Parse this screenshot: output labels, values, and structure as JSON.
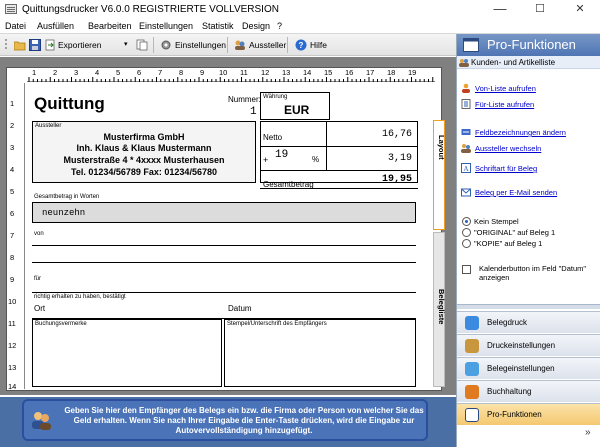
{
  "window": {
    "title": "Quittungsdrucker V6.0.0  REGISTRIERTE VOLLVERSION",
    "minimize": "—",
    "maximize": "☐",
    "close": "✕"
  },
  "menu": [
    "Datei",
    "Ausfüllen",
    "Bearbeiten",
    "Einstellungen",
    "Statistik",
    "Design",
    "?"
  ],
  "toolbar": {
    "export": "Exportieren",
    "settings": "Einstellungen",
    "issuer": "Aussteller",
    "help": "Hilfe"
  },
  "ruler": {
    "h": [
      "1",
      "2",
      "3",
      "4",
      "5",
      "6",
      "7",
      "8",
      "9",
      "10",
      "11",
      "12",
      "13",
      "14",
      "15",
      "16",
      "17",
      "18",
      "19"
    ],
    "v": [
      "1",
      "2",
      "3",
      "4",
      "5",
      "6",
      "7",
      "8",
      "9",
      "10",
      "11",
      "12",
      "13",
      "14"
    ]
  },
  "receipt": {
    "title": "Quittung",
    "number_label": "Nummer:",
    "number": "1",
    "currency_label": "Währung",
    "currency": "EUR",
    "issuer_label": "Aussteller",
    "issuer_lines": [
      "Musterfirma GmbH",
      "Inh. Klaus & Klaus Mustermann",
      "Musterstraße 4  *  4xxxx Musterhausen",
      "Tel. 01234/56789  Fax: 01234/56780"
    ],
    "netto_label": "Netto",
    "netto": "16,76",
    "tax_plus": "+",
    "tax_rate": "19",
    "tax_pct": "%",
    "tax": "3,19",
    "gross_label": "Gesamtbetrag",
    "gross": "19,95",
    "words_label": "Gesamtbetrag in Worten",
    "words": "neunzehn",
    "from_label": "von",
    "for_label": "für",
    "received_label": "richtig erhalten zu haben, bestätigt",
    "place_label": "Ort",
    "date_label": "Datum",
    "booking_label": "Buchungsvermerke",
    "signature_label": "Stempel/Unterschrift des Empfängers"
  },
  "tabs": {
    "layout": "Layout",
    "list": "Belegliste"
  },
  "status": {
    "message": "Geben Sie hier den Empfänger des Belegs ein bzw. die Firma oder Person von welcher Sie das Geld erhalten. Wenn Sie nach Ihrer Eingabe die Enter-Taste drücken, wird die Eingabe zur Autovervollständigung hinzugefügt."
  },
  "panel": {
    "title": "Pro-Funktionen",
    "section": "Kunden- und Artikelliste",
    "links": [
      "Von-Liste aufrufen",
      "Für-Liste aufrufen",
      "Feldbezeichnungen ändern",
      "Aussteller wechseln",
      "Schriftart für Beleg",
      "Beleg per E-Mail senden"
    ],
    "radios": [
      "Kein Stempel",
      "\"ORIGINAL\" auf Beleg 1",
      "\"KOPIE\" auf Beleg 1"
    ],
    "checkbox": "Kalenderbutton im Feld \"Datum\" anzeigen",
    "nav": [
      "Belegdruck",
      "Druckeinstellungen",
      "Belegeinstellungen",
      "Buchhaltung",
      "Pro-Funktionen"
    ],
    "nav_more": "»"
  }
}
